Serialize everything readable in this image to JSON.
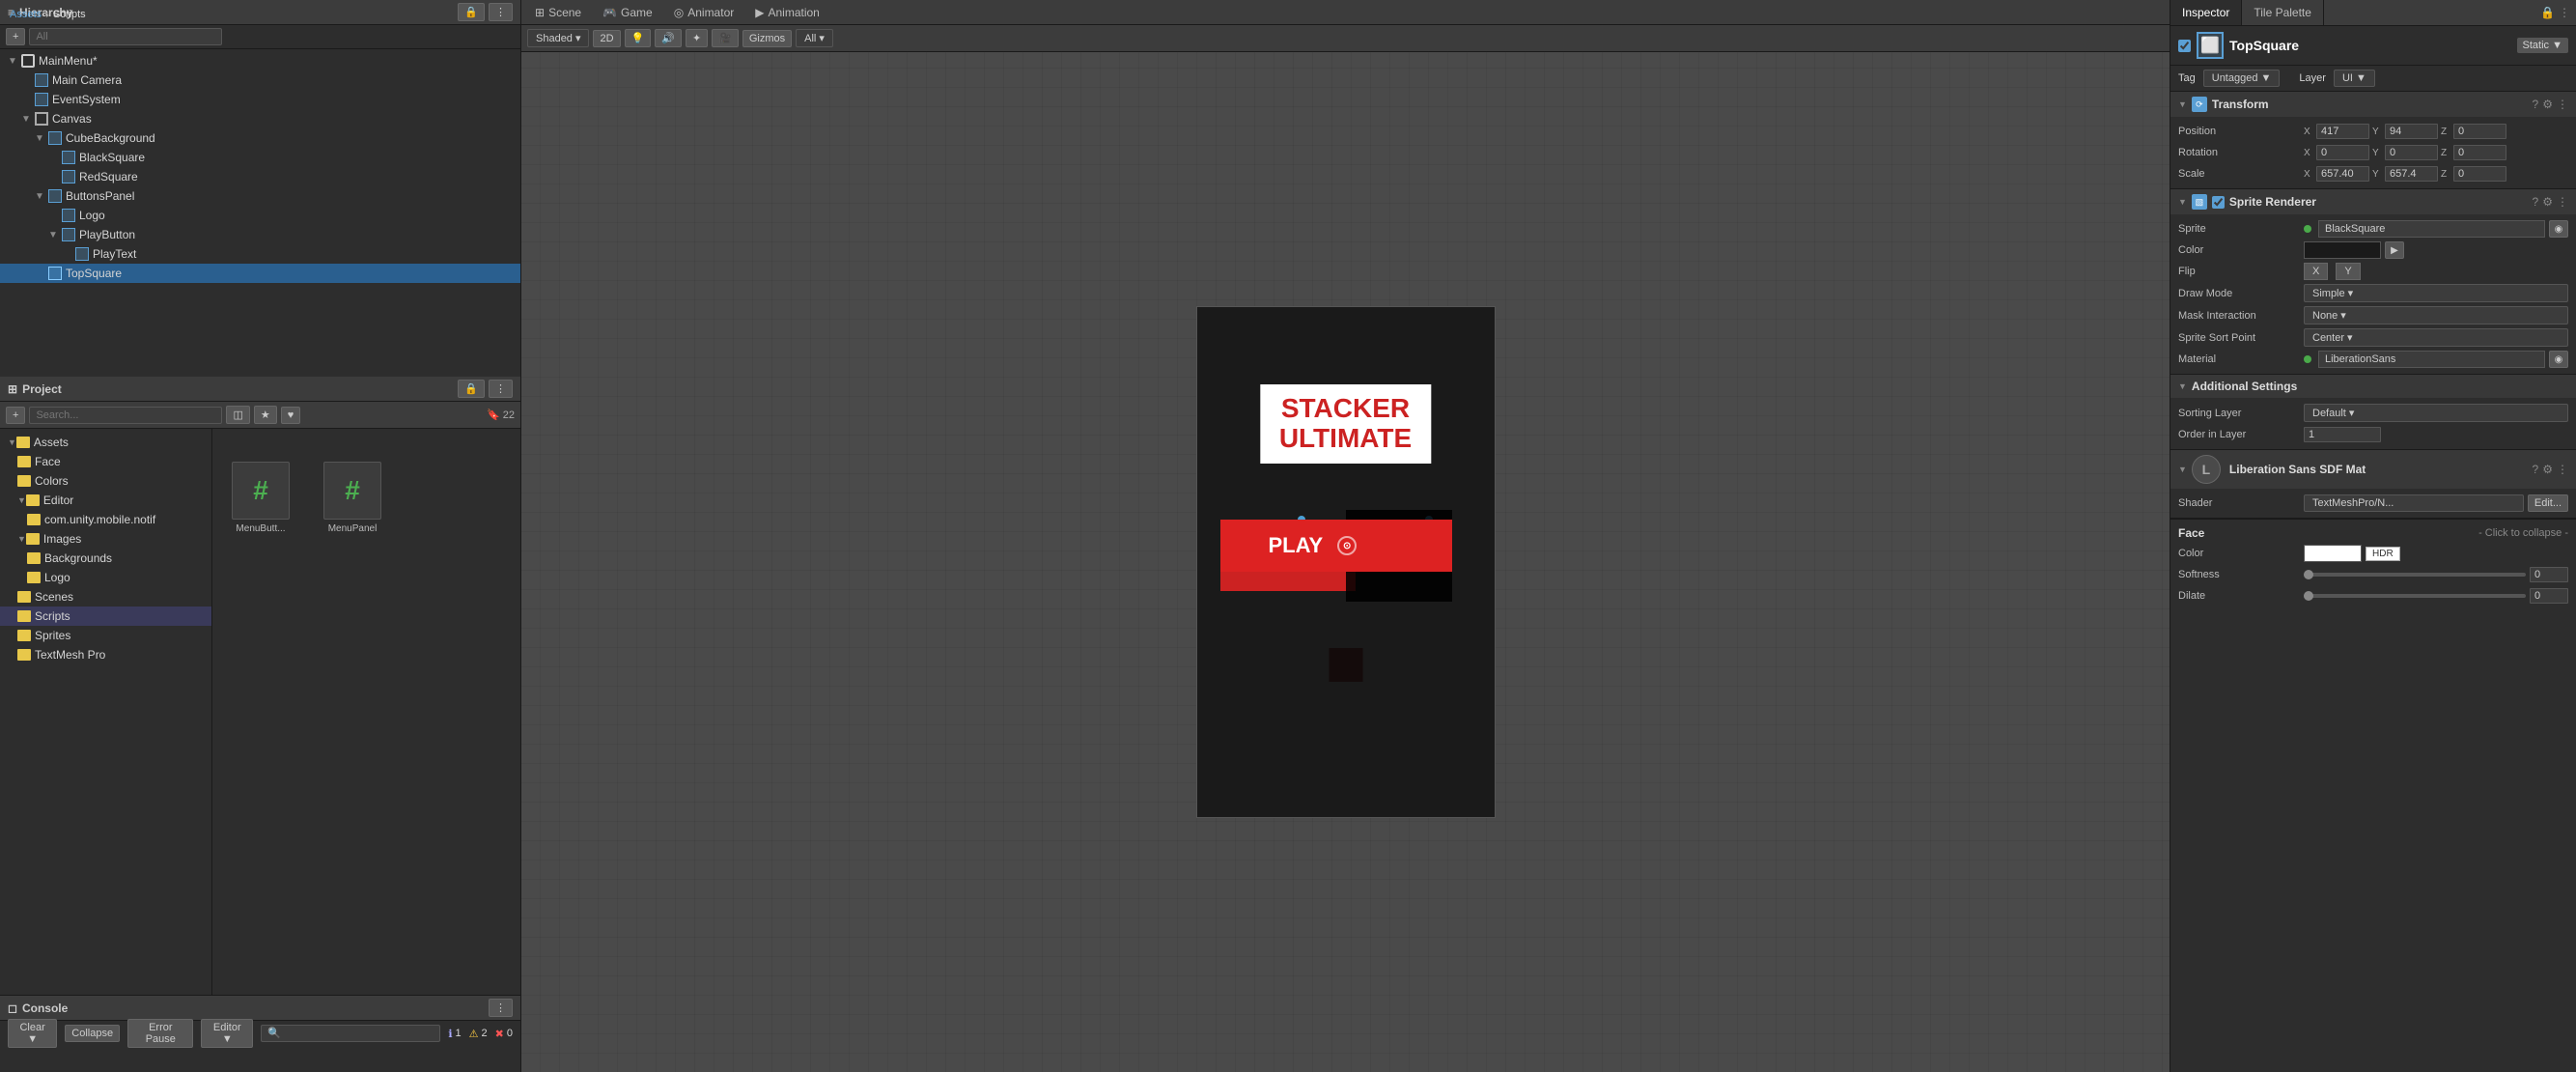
{
  "app": {
    "title": "Unity Editor"
  },
  "top_tabs": [
    {
      "id": "hierarchy",
      "label": "Hierarchy",
      "icon": "≡",
      "active": true
    },
    {
      "id": "scene",
      "label": "Scene",
      "icon": "⊞",
      "active": false
    },
    {
      "id": "game",
      "label": "Game",
      "icon": "🎮",
      "active": false
    },
    {
      "id": "animator",
      "label": "Animator",
      "icon": "◎",
      "active": false
    },
    {
      "id": "animation",
      "label": "Animation",
      "icon": "▶",
      "active": false
    }
  ],
  "hierarchy": {
    "title": "Hierarchy",
    "search_placeholder": "All",
    "items": [
      {
        "label": "MainMenu*",
        "depth": 0,
        "icon": "scene",
        "expanded": true
      },
      {
        "label": "Main Camera",
        "depth": 1,
        "icon": "camera"
      },
      {
        "label": "EventSystem",
        "depth": 1,
        "icon": "cube"
      },
      {
        "label": "Canvas",
        "depth": 1,
        "icon": "canvas",
        "expanded": true
      },
      {
        "label": "CubeBackground",
        "depth": 2,
        "icon": "cube",
        "expanded": true
      },
      {
        "label": "BlackSquare",
        "depth": 3,
        "icon": "cube"
      },
      {
        "label": "RedSquare",
        "depth": 3,
        "icon": "cube"
      },
      {
        "label": "ButtonsPanel",
        "depth": 2,
        "icon": "cube",
        "expanded": true
      },
      {
        "label": "Logo",
        "depth": 3,
        "icon": "cube"
      },
      {
        "label": "PlayButton",
        "depth": 3,
        "icon": "cube",
        "expanded": true
      },
      {
        "label": "PlayText",
        "depth": 4,
        "icon": "cube"
      },
      {
        "label": "TopSquare",
        "depth": 2,
        "icon": "cube",
        "selected": true
      }
    ]
  },
  "scene": {
    "title": "Scene",
    "shade_mode": "Shaded",
    "view_mode": "2D",
    "gizmos": "Gizmos",
    "search_placeholder": "All"
  },
  "game_canvas": {
    "title_line1": "STACKER",
    "title_line2": "ULTIMATE",
    "play_label": "PLAY"
  },
  "inspector": {
    "title": "Inspector",
    "tile_palette": "Tile Palette",
    "object": {
      "name": "TopSquare",
      "static_label": "Static ▼"
    },
    "tag": {
      "label": "Tag",
      "value": "Untagged ▼"
    },
    "layer": {
      "label": "Layer",
      "value": "UI ▼"
    },
    "transform": {
      "title": "Transform",
      "position": {
        "label": "Position",
        "x": "417",
        "y": "94",
        "z": "0"
      },
      "rotation": {
        "label": "Rotation",
        "x": "0",
        "y": "0",
        "z": "0"
      },
      "scale": {
        "label": "Scale",
        "x": "657.40",
        "y": "657.4",
        "z": "0"
      }
    },
    "sprite_renderer": {
      "title": "Sprite Renderer",
      "sprite": {
        "label": "Sprite",
        "value": "BlackSquare"
      },
      "color": {
        "label": "Color"
      },
      "flip": {
        "label": "Flip",
        "x": "X",
        "y": "Y"
      },
      "draw_mode": {
        "label": "Draw Mode",
        "value": "Simple"
      },
      "mask_interaction": {
        "label": "Mask Interaction",
        "value": "None"
      },
      "sprite_sort_point": {
        "label": "Sprite Sort Point",
        "value": "Center"
      },
      "material": {
        "label": "Material",
        "value": "LiberationSans"
      }
    },
    "additional_settings": {
      "title": "Additional Settings",
      "sorting_layer": {
        "label": "Sorting Layer",
        "value": "Default"
      },
      "order_in_layer": {
        "label": "Order in Layer",
        "value": "1"
      }
    },
    "material_section": {
      "name": "Liberation Sans SDF Mat",
      "shader_label": "Shader",
      "shader_value": "TextMeshPro/N...",
      "edit_label": "Edit..."
    },
    "face": {
      "label": "Face",
      "collapse_label": "- Click to collapse -",
      "color": {
        "label": "Color",
        "hdr_label": "HDR"
      },
      "softness": {
        "label": "Softness",
        "value": "0"
      },
      "dilate": {
        "label": "Dilate",
        "value": "0"
      }
    }
  },
  "console": {
    "title": "Console",
    "clear_btn": "Clear ▼",
    "collapse_btn": "Collapse",
    "error_pause_btn": "Error Pause",
    "editor_btn": "Editor ▼",
    "info_count": "1",
    "warn_count": "2",
    "error_count": "0"
  },
  "project": {
    "title": "Project",
    "folders": [
      {
        "label": "Assets",
        "depth": 0,
        "expanded": true
      },
      {
        "label": "Colors",
        "depth": 1
      },
      {
        "label": "Editor",
        "depth": 1,
        "expanded": true
      },
      {
        "label": "com.unity.mobile.notif",
        "depth": 2
      },
      {
        "label": "Images",
        "depth": 1,
        "expanded": true
      },
      {
        "label": "Backgrounds",
        "depth": 2
      },
      {
        "label": "Logo",
        "depth": 2
      },
      {
        "label": "Scenes",
        "depth": 1
      },
      {
        "label": "Scripts",
        "depth": 1
      },
      {
        "label": "Sprites",
        "depth": 1
      },
      {
        "label": "TextMesh Pro",
        "depth": 1
      }
    ],
    "current_path": [
      "Assets",
      "Scripts"
    ],
    "files": [
      {
        "name": "MenuButt...",
        "type": "cs"
      },
      {
        "name": "MenuPanel",
        "type": "cs"
      }
    ],
    "file_count": "22"
  }
}
